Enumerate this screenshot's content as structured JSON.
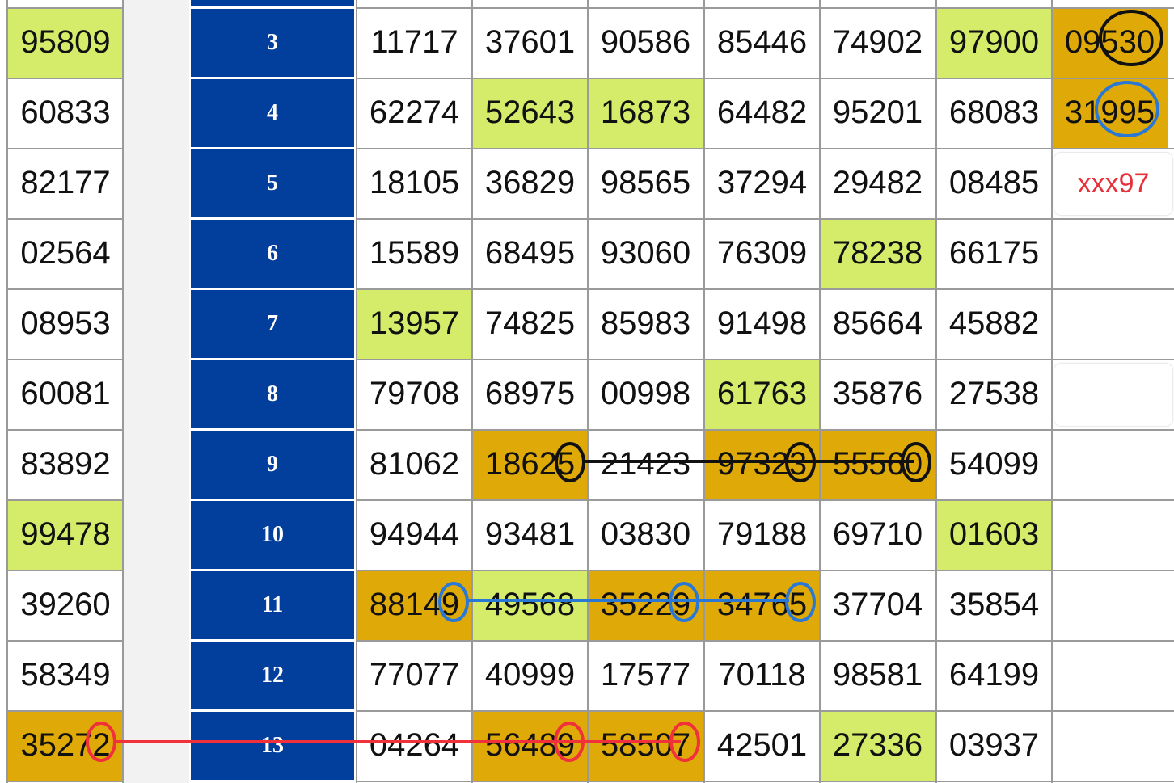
{
  "left_column": [
    "95809",
    "60833",
    "82177",
    "02564",
    "08953",
    "60081",
    "83892",
    "99478",
    "39260",
    "58349",
    "35272"
  ],
  "row_numbers": [
    "3",
    "4",
    "5",
    "6",
    "7",
    "8",
    "9",
    "10",
    "11",
    "12",
    "13"
  ],
  "grid": [
    [
      "11717",
      "37601",
      "90586",
      "85446",
      "74902",
      "97900",
      "09530"
    ],
    [
      "62274",
      "52643",
      "16873",
      "64482",
      "95201",
      "68083",
      "31995"
    ],
    [
      "18105",
      "36829",
      "98565",
      "37294",
      "29482",
      "08485",
      ""
    ],
    [
      "15589",
      "68495",
      "93060",
      "76309",
      "78238",
      "66175",
      ""
    ],
    [
      "13957",
      "74825",
      "85983",
      "91498",
      "85664",
      "45882",
      ""
    ],
    [
      "79708",
      "68975",
      "00998",
      "61763",
      "35876",
      "27538",
      ""
    ],
    [
      "81062",
      "18625",
      "21423",
      "97323",
      "55560",
      "54099",
      ""
    ],
    [
      "94944",
      "93481",
      "03830",
      "79188",
      "69710",
      "01603",
      ""
    ],
    [
      "88149",
      "49568",
      "35229",
      "34765",
      "37704",
      "35854",
      ""
    ],
    [
      "77077",
      "40999",
      "17577",
      "70118",
      "98581",
      "64199",
      ""
    ],
    [
      "04264",
      "56489",
      "58507",
      "42501",
      "27336",
      "03937",
      ""
    ]
  ],
  "prediction_label": "xxx97",
  "colors": {
    "header_blue": "#023e9c",
    "highlight_green": "#d4ec6a",
    "highlight_gold": "#dfaa08",
    "marker_black": "#111111",
    "marker_blue": "#2a78d6",
    "marker_red": "#f0303a",
    "prediction_red": "#e8303a"
  }
}
